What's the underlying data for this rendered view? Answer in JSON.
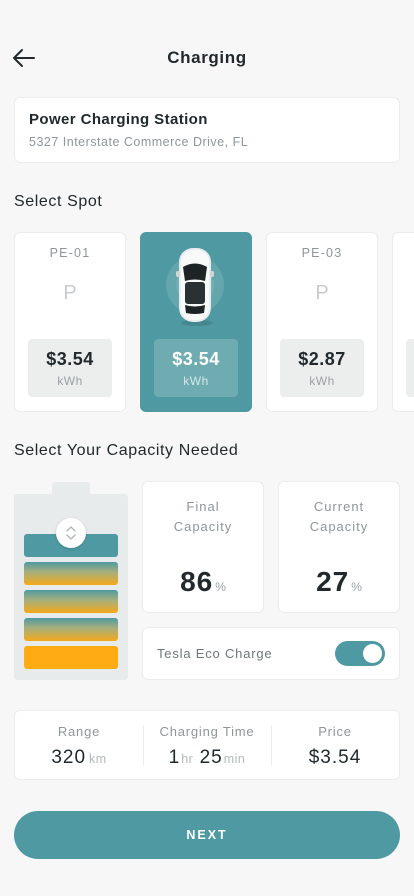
{
  "header": {
    "title": "Charging",
    "back_icon": "arrow-left-icon"
  },
  "station": {
    "name": "Power Charging Station",
    "address": "5327 Interstate Commerce Drive, FL"
  },
  "select_spot": {
    "title": "Select Spot",
    "spots": [
      {
        "code": "PE-01",
        "symbol": "P",
        "price": "$3.54",
        "unit": "kWh",
        "selected": false
      },
      {
        "code": "",
        "symbol": "",
        "price": "$3.54",
        "unit": "kWh",
        "selected": true,
        "icon": "car-top-view-icon"
      },
      {
        "code": "PE-03",
        "symbol": "P",
        "price": "$2.87",
        "unit": "kWh",
        "selected": false
      }
    ]
  },
  "capacity": {
    "title": "Select Your Capacity Needed",
    "final": {
      "label": "Final Capacity",
      "value": "86",
      "unit": "%"
    },
    "current": {
      "label": "Current Capacity",
      "value": "27",
      "unit": "%"
    },
    "eco": {
      "label": "Tesla Eco Charge",
      "enabled": true
    }
  },
  "summary": {
    "range": {
      "label": "Range",
      "value": "320",
      "unit": "km"
    },
    "time": {
      "label": "Charging Time",
      "hours": "1",
      "hours_unit": "hr",
      "minutes": "25",
      "minutes_unit": "min"
    },
    "price": {
      "label": "Price",
      "value": "$3.54"
    }
  },
  "next_label": "NEXT",
  "colors": {
    "accent": "#4f9aa2",
    "orange": "#ffab14",
    "background": "#f7f7f7"
  }
}
